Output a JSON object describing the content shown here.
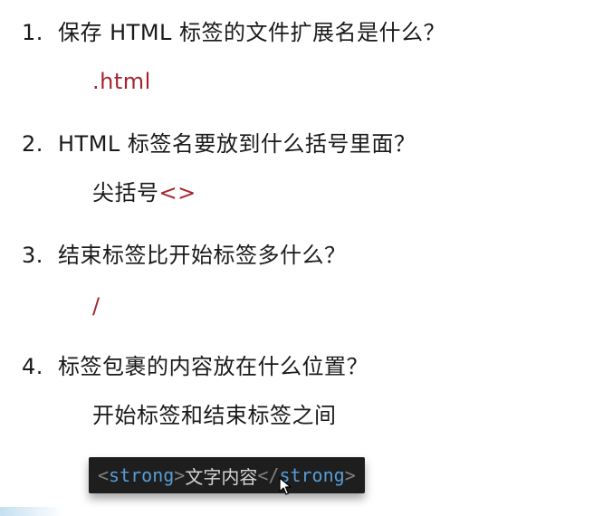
{
  "questions": [
    {
      "num": "1.",
      "text": "保存 HTML 标签的文件扩展名是什么？",
      "answer": ".html"
    },
    {
      "num": "2.",
      "text": "HTML 标签名要放到什么括号里面？",
      "answer_plain": "尖括号",
      "answer_red": "<>"
    },
    {
      "num": "3.",
      "text": "结束标签比开始标签多什么？",
      "answer": "/"
    },
    {
      "num": "4.",
      "text": "标签包裹的内容放在什么位置？",
      "answer": "开始标签和结束标签之间"
    }
  ],
  "code_example": {
    "open_lt": "<",
    "open_name": "strong",
    "open_gt": ">",
    "content": "文字内容",
    "close_lt": "</",
    "close_name": "strong",
    "close_gt": ">"
  },
  "colors": {
    "answer_accent": "#a8242c",
    "code_bg": "#1e1e1e",
    "code_tag": "#569cd6",
    "code_bracket": "#808080",
    "code_text": "#d4d4d4"
  },
  "icons": {
    "cursor": "mouse-pointer-icon"
  }
}
